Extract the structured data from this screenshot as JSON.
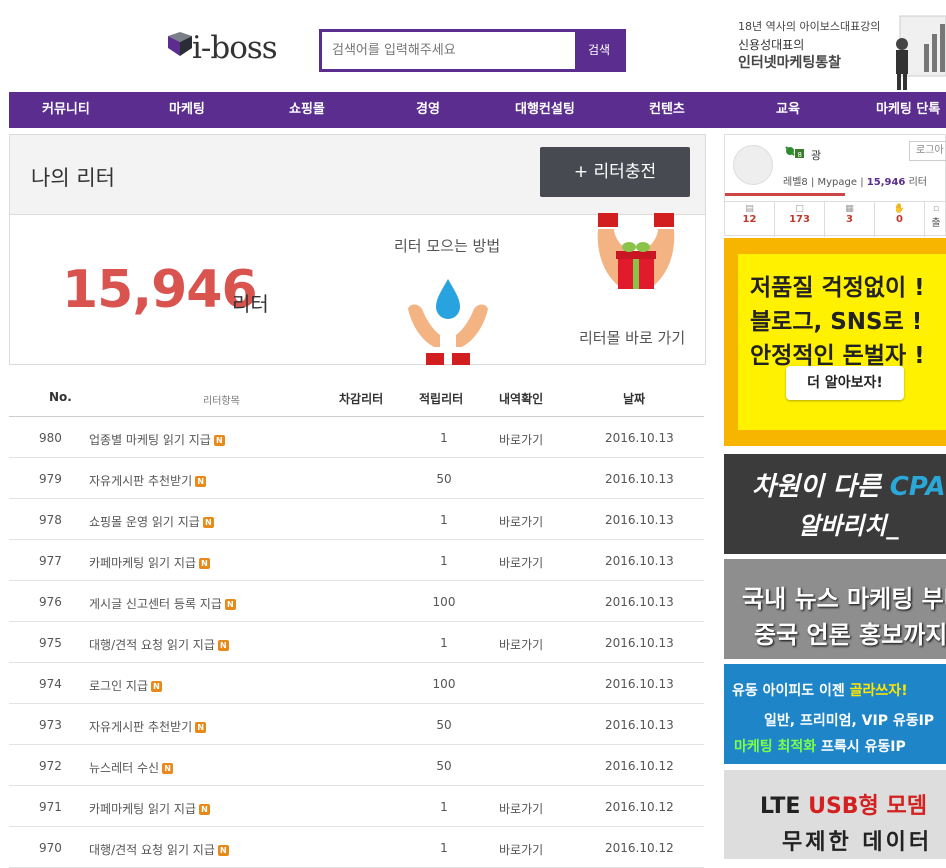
{
  "header": {
    "logo_text": "i-boss",
    "search_placeholder": "검색어를 입력해주세요",
    "search_button": "검색",
    "top_ad": {
      "line1": "18년 역사의 아이보스대표강의",
      "line2": "신용성대표의",
      "line3": "인터넷마케팅통찰"
    }
  },
  "nav": {
    "items": [
      "커뮤니티",
      "마케팅",
      "쇼핑몰",
      "경영",
      "대행컨설팅",
      "컨텐츠",
      "교육",
      "마케팅 단톡"
    ]
  },
  "panel": {
    "title": "나의 리터",
    "charge_button": "+ 리터충전",
    "amount": "15,946",
    "unit": "리터",
    "how_to_collect": "리터 모으는 방법",
    "shop_link": "리터몰 바로 가기"
  },
  "table": {
    "headers": {
      "no": "No.",
      "item": "리터항목",
      "deduct": "차감리터",
      "earn": "적립리터",
      "history": "내역확인",
      "date": "날짜"
    },
    "badge": "N",
    "rows": [
      {
        "no": "980",
        "item": "업종별 마케팅 읽기 지급",
        "deduct": "",
        "earn": "1",
        "history": "바로가기",
        "date": "2016.10.13"
      },
      {
        "no": "979",
        "item": "자유게시판 추천받기",
        "deduct": "",
        "earn": "50",
        "history": "",
        "date": "2016.10.13"
      },
      {
        "no": "978",
        "item": "쇼핑몰 운영 읽기 지급",
        "deduct": "",
        "earn": "1",
        "history": "바로가기",
        "date": "2016.10.13"
      },
      {
        "no": "977",
        "item": "카페마케팅 읽기 지급",
        "deduct": "",
        "earn": "1",
        "history": "바로가기",
        "date": "2016.10.13"
      },
      {
        "no": "976",
        "item": "게시글 신고센터 등록 지급",
        "deduct": "",
        "earn": "100",
        "history": "",
        "date": "2016.10.13"
      },
      {
        "no": "975",
        "item": "대행/견적 요청 읽기 지급",
        "deduct": "",
        "earn": "1",
        "history": "바로가기",
        "date": "2016.10.13"
      },
      {
        "no": "974",
        "item": "로그인 지급",
        "deduct": "",
        "earn": "100",
        "history": "",
        "date": "2016.10.13"
      },
      {
        "no": "973",
        "item": "자유게시판 추천받기",
        "deduct": "",
        "earn": "50",
        "history": "",
        "date": "2016.10.13"
      },
      {
        "no": "972",
        "item": "뉴스레터 수신",
        "deduct": "",
        "earn": "50",
        "history": "",
        "date": "2016.10.12"
      },
      {
        "no": "971",
        "item": "카페마케팅 읽기 지급",
        "deduct": "",
        "earn": "1",
        "history": "바로가기",
        "date": "2016.10.12"
      },
      {
        "no": "970",
        "item": "대행/견적 요청 읽기 지급",
        "deduct": "",
        "earn": "1",
        "history": "바로가기",
        "date": "2016.10.12"
      }
    ]
  },
  "sidebar": {
    "user_name": "광",
    "login_button": "로그아",
    "level": "레벨8",
    "mypage": "Mypage",
    "points": "15,946",
    "points_unit": "리터",
    "stats": [
      {
        "icon": "document-icon",
        "value": "12"
      },
      {
        "icon": "comment-icon",
        "value": "173"
      },
      {
        "icon": "bookmark-icon",
        "value": "3"
      },
      {
        "icon": "hand-icon",
        "value": "0"
      },
      {
        "icon": "calendar-icon",
        "value": "출"
      }
    ]
  },
  "ads": {
    "ad1": {
      "line1": "저품질 걱정없이 !",
      "line2": "블로그, SNS로 !",
      "line3": "안정적인 돈벌자 !",
      "button": "더 알아보자!"
    },
    "ad2": {
      "line1_a": "차원이 다른 ",
      "line1_b": "CPA",
      "line2": "알바리치_"
    },
    "ad3": {
      "line1": "국내 뉴스 마케팅 부터",
      "line2": "중국 언론 홍보까지!"
    },
    "ad4": {
      "line1_a": "유동 아이피도 이젠 ",
      "line1_b": "골라쓰자!",
      "line2": "일반, 프리미엄, VIP 유동IP",
      "line3_a": "마케팅 최적화",
      "line3_b": " 프록시 유동IP"
    },
    "ad5": {
      "line1_a": "LTE ",
      "line1_b": "USB형 모뎀",
      "line2": "무제한 데이터"
    }
  },
  "colors": {
    "brand_purple": "#5a2d8e",
    "amount_red": "#d9534f",
    "badge_orange": "#e88a1a"
  }
}
